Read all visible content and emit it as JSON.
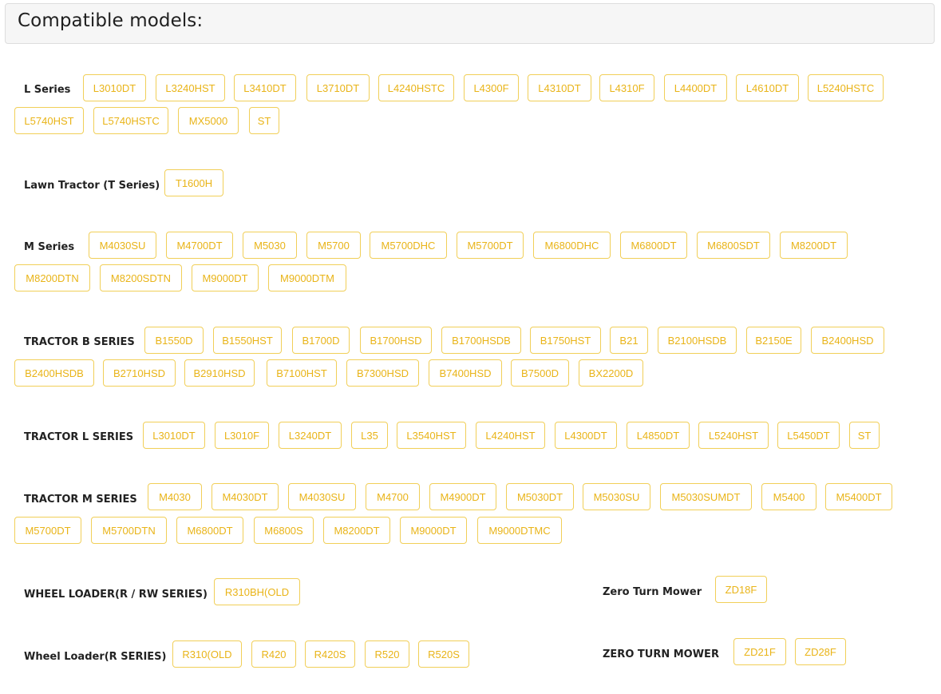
{
  "page_title": "Compatible models:",
  "colors": {
    "accent_border": "#f1cf58",
    "accent_text": "#e9b418",
    "label_text": "#222222"
  },
  "categories": [
    {
      "label": "L Series",
      "models": [
        "L3010DT",
        "L3240HST",
        "L3410DT",
        "L3710DT",
        "L4240HSTC",
        "L4300F",
        "L4310DT",
        "L4310F",
        "L4400DT",
        "L4610DT",
        "L5240HSTC",
        "L5740HST",
        "L5740HSTC",
        "MX5000",
        "ST"
      ]
    },
    {
      "label": "Lawn Tractor (T Series)",
      "models": [
        "T1600H"
      ]
    },
    {
      "label": "M Series",
      "models": [
        "M4030SU",
        "M4700DT",
        "M5030",
        "M5700",
        "M5700DHC",
        "M5700DT",
        "M6800DHC",
        "M6800DT",
        "M6800SDT",
        "M8200DT",
        "M8200DTN",
        "M8200SDTN",
        "M9000DT",
        "M9000DTM"
      ]
    },
    {
      "label": "TRACTOR B SERIES",
      "models": [
        "B1550D",
        "B1550HST",
        "B1700D",
        "B1700HSD",
        "B1700HSDB",
        "B1750HST",
        "B21",
        "B2100HSDB",
        "B2150E",
        "B2400HSD",
        "B2400HSDB",
        "B2710HSD",
        "B2910HSD",
        "B7100HST",
        "B7300HSD",
        "B7400HSD",
        "B7500D",
        "BX2200D"
      ]
    },
    {
      "label": "TRACTOR L SERIES",
      "models": [
        "L3010DT",
        "L3010F",
        "L3240DT",
        "L35",
        "L3540HST",
        "L4240HST",
        "L4300DT",
        "L4850DT",
        "L5240HST",
        "L5450DT",
        "ST"
      ]
    },
    {
      "label": "TRACTOR M SERIES",
      "models": [
        "M4030",
        "M4030DT",
        "M4030SU",
        "M4700",
        "M4900DT",
        "M5030DT",
        "M5030SU",
        "M5030SUMDT",
        "M5400",
        "M5400DT",
        "M5700DT",
        "M5700DTN",
        "M6800DT",
        "M6800S",
        "M8200DT",
        "M9000DT",
        "M9000DTMC"
      ]
    },
    {
      "label": "WHEEL LOADER(R / RW SERIES)",
      "models": [
        "R310BH(OLD"
      ]
    },
    {
      "label": "Zero Turn Mower",
      "models": [
        "ZD18F"
      ]
    },
    {
      "label": "Wheel Loader(R SERIES)",
      "models": [
        "R310(OLD",
        "R420",
        "R420S",
        "R520",
        "R520S"
      ]
    },
    {
      "label": "ZERO TURN MOWER",
      "models": [
        "ZD21F",
        "ZD28F"
      ]
    }
  ]
}
